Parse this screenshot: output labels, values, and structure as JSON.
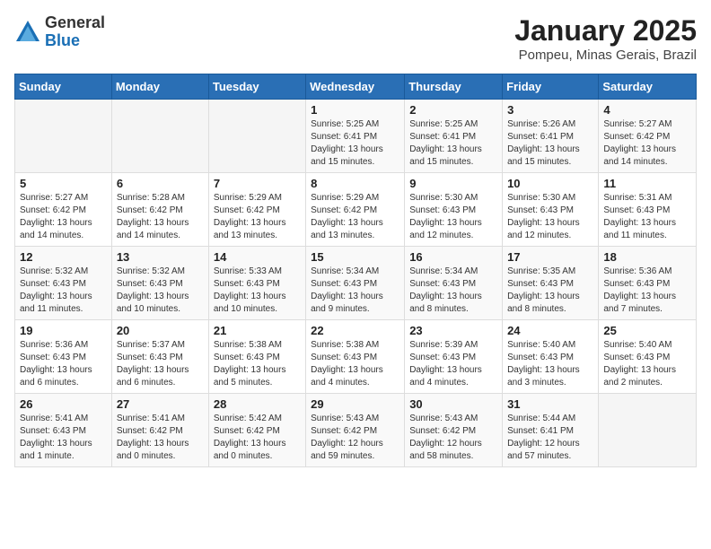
{
  "logo": {
    "general": "General",
    "blue": "Blue"
  },
  "header": {
    "title": "January 2025",
    "subtitle": "Pompeu, Minas Gerais, Brazil"
  },
  "weekdays": [
    "Sunday",
    "Monday",
    "Tuesday",
    "Wednesday",
    "Thursday",
    "Friday",
    "Saturday"
  ],
  "weeks": [
    [
      {
        "day": "",
        "info": ""
      },
      {
        "day": "",
        "info": ""
      },
      {
        "day": "",
        "info": ""
      },
      {
        "day": "1",
        "info": "Sunrise: 5:25 AM\nSunset: 6:41 PM\nDaylight: 13 hours\nand 15 minutes."
      },
      {
        "day": "2",
        "info": "Sunrise: 5:25 AM\nSunset: 6:41 PM\nDaylight: 13 hours\nand 15 minutes."
      },
      {
        "day": "3",
        "info": "Sunrise: 5:26 AM\nSunset: 6:41 PM\nDaylight: 13 hours\nand 15 minutes."
      },
      {
        "day": "4",
        "info": "Sunrise: 5:27 AM\nSunset: 6:42 PM\nDaylight: 13 hours\nand 14 minutes."
      }
    ],
    [
      {
        "day": "5",
        "info": "Sunrise: 5:27 AM\nSunset: 6:42 PM\nDaylight: 13 hours\nand 14 minutes."
      },
      {
        "day": "6",
        "info": "Sunrise: 5:28 AM\nSunset: 6:42 PM\nDaylight: 13 hours\nand 14 minutes."
      },
      {
        "day": "7",
        "info": "Sunrise: 5:29 AM\nSunset: 6:42 PM\nDaylight: 13 hours\nand 13 minutes."
      },
      {
        "day": "8",
        "info": "Sunrise: 5:29 AM\nSunset: 6:42 PM\nDaylight: 13 hours\nand 13 minutes."
      },
      {
        "day": "9",
        "info": "Sunrise: 5:30 AM\nSunset: 6:43 PM\nDaylight: 13 hours\nand 12 minutes."
      },
      {
        "day": "10",
        "info": "Sunrise: 5:30 AM\nSunset: 6:43 PM\nDaylight: 13 hours\nand 12 minutes."
      },
      {
        "day": "11",
        "info": "Sunrise: 5:31 AM\nSunset: 6:43 PM\nDaylight: 13 hours\nand 11 minutes."
      }
    ],
    [
      {
        "day": "12",
        "info": "Sunrise: 5:32 AM\nSunset: 6:43 PM\nDaylight: 13 hours\nand 11 minutes."
      },
      {
        "day": "13",
        "info": "Sunrise: 5:32 AM\nSunset: 6:43 PM\nDaylight: 13 hours\nand 10 minutes."
      },
      {
        "day": "14",
        "info": "Sunrise: 5:33 AM\nSunset: 6:43 PM\nDaylight: 13 hours\nand 10 minutes."
      },
      {
        "day": "15",
        "info": "Sunrise: 5:34 AM\nSunset: 6:43 PM\nDaylight: 13 hours\nand 9 minutes."
      },
      {
        "day": "16",
        "info": "Sunrise: 5:34 AM\nSunset: 6:43 PM\nDaylight: 13 hours\nand 8 minutes."
      },
      {
        "day": "17",
        "info": "Sunrise: 5:35 AM\nSunset: 6:43 PM\nDaylight: 13 hours\nand 8 minutes."
      },
      {
        "day": "18",
        "info": "Sunrise: 5:36 AM\nSunset: 6:43 PM\nDaylight: 13 hours\nand 7 minutes."
      }
    ],
    [
      {
        "day": "19",
        "info": "Sunrise: 5:36 AM\nSunset: 6:43 PM\nDaylight: 13 hours\nand 6 minutes."
      },
      {
        "day": "20",
        "info": "Sunrise: 5:37 AM\nSunset: 6:43 PM\nDaylight: 13 hours\nand 6 minutes."
      },
      {
        "day": "21",
        "info": "Sunrise: 5:38 AM\nSunset: 6:43 PM\nDaylight: 13 hours\nand 5 minutes."
      },
      {
        "day": "22",
        "info": "Sunrise: 5:38 AM\nSunset: 6:43 PM\nDaylight: 13 hours\nand 4 minutes."
      },
      {
        "day": "23",
        "info": "Sunrise: 5:39 AM\nSunset: 6:43 PM\nDaylight: 13 hours\nand 4 minutes."
      },
      {
        "day": "24",
        "info": "Sunrise: 5:40 AM\nSunset: 6:43 PM\nDaylight: 13 hours\nand 3 minutes."
      },
      {
        "day": "25",
        "info": "Sunrise: 5:40 AM\nSunset: 6:43 PM\nDaylight: 13 hours\nand 2 minutes."
      }
    ],
    [
      {
        "day": "26",
        "info": "Sunrise: 5:41 AM\nSunset: 6:43 PM\nDaylight: 13 hours\nand 1 minute."
      },
      {
        "day": "27",
        "info": "Sunrise: 5:41 AM\nSunset: 6:42 PM\nDaylight: 13 hours\nand 0 minutes."
      },
      {
        "day": "28",
        "info": "Sunrise: 5:42 AM\nSunset: 6:42 PM\nDaylight: 13 hours\nand 0 minutes."
      },
      {
        "day": "29",
        "info": "Sunrise: 5:43 AM\nSunset: 6:42 PM\nDaylight: 12 hours\nand 59 minutes."
      },
      {
        "day": "30",
        "info": "Sunrise: 5:43 AM\nSunset: 6:42 PM\nDaylight: 12 hours\nand 58 minutes."
      },
      {
        "day": "31",
        "info": "Sunrise: 5:44 AM\nSunset: 6:41 PM\nDaylight: 12 hours\nand 57 minutes."
      },
      {
        "day": "",
        "info": ""
      }
    ]
  ]
}
